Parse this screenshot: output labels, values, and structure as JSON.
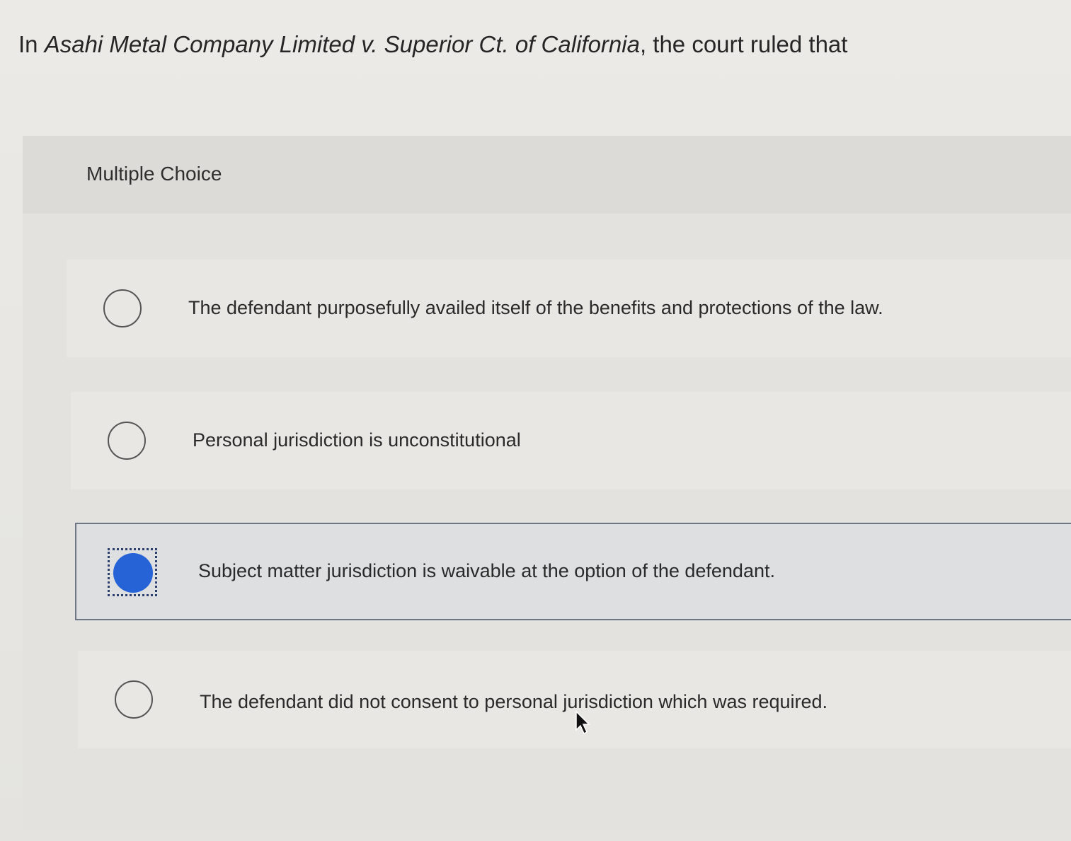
{
  "question": {
    "prefix": "In ",
    "case_name": "Asahi Metal Company Limited v. Superior Ct. of California",
    "suffix": ", the court ruled that"
  },
  "multiple_choice": {
    "label": "Multiple Choice",
    "options": [
      {
        "text": "The defendant purposefully availed itself of the benefits and protections of the law.",
        "selected": false
      },
      {
        "text": "Personal jurisdiction is unconstitutional",
        "selected": false
      },
      {
        "text": "Subject matter jurisdiction is waivable at the option of the defendant.",
        "selected": true
      },
      {
        "text": "The defendant did not consent to personal jurisdiction which was required.",
        "selected": false
      }
    ]
  },
  "colors": {
    "selected_radio": "#2563d6",
    "selected_border": "#6f7684"
  },
  "icons": {
    "cursor": "mouse-pointer-icon"
  }
}
